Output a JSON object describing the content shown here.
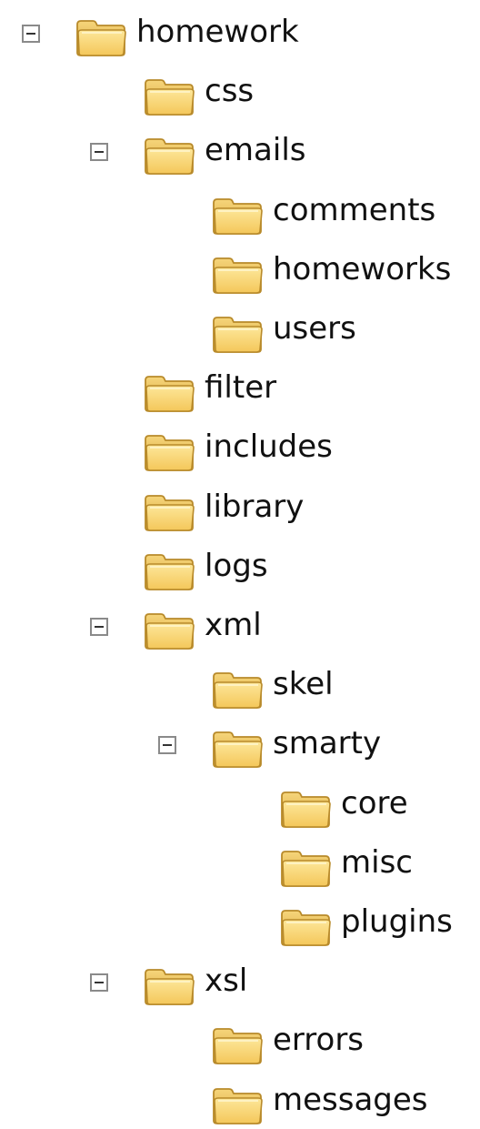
{
  "tree": [
    {
      "label": "homework",
      "depth": 0,
      "expanded": true
    },
    {
      "label": "css",
      "depth": 1
    },
    {
      "label": "emails",
      "depth": 1,
      "expanded": true
    },
    {
      "label": "comments",
      "depth": 2
    },
    {
      "label": "homeworks",
      "depth": 2
    },
    {
      "label": "users",
      "depth": 2
    },
    {
      "label": "filter",
      "depth": 1
    },
    {
      "label": "includes",
      "depth": 1
    },
    {
      "label": "library",
      "depth": 1
    },
    {
      "label": "logs",
      "depth": 1
    },
    {
      "label": "xml",
      "depth": 1,
      "expanded": true
    },
    {
      "label": "skel",
      "depth": 2
    },
    {
      "label": "smarty",
      "depth": 2,
      "expanded": true
    },
    {
      "label": "core",
      "depth": 3
    },
    {
      "label": "misc",
      "depth": 3
    },
    {
      "label": "plugins",
      "depth": 3
    },
    {
      "label": "xsl",
      "depth": 1,
      "expanded": true
    },
    {
      "label": "errors",
      "depth": 2
    },
    {
      "label": "messages",
      "depth": 2
    }
  ],
  "icons": {
    "folder": "folder-icon",
    "toggle": "collapse-minus-icon"
  },
  "colors": {
    "folder_light": "#fde79a",
    "folder_dark": "#d9a83a",
    "folder_outline": "#b88a2a",
    "text": "#111111"
  }
}
